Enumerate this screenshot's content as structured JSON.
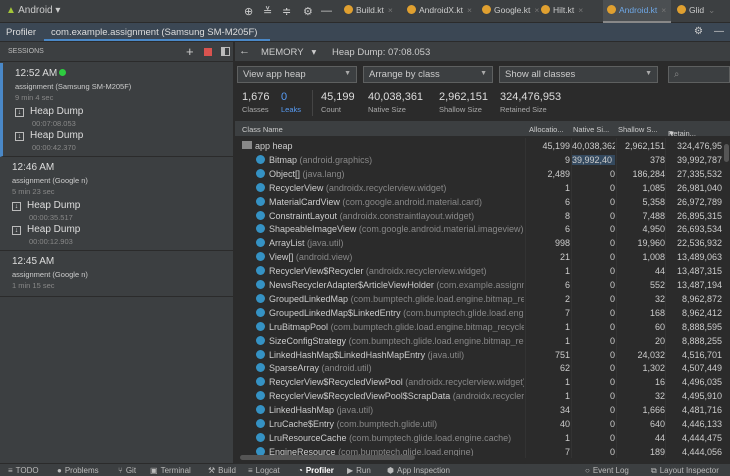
{
  "toolbar": {
    "project": "Android",
    "tabs": [
      {
        "name": "Build.kt"
      },
      {
        "name": "AndroidX.kt"
      },
      {
        "name": "Google.kt"
      },
      {
        "name": "Hilt.kt"
      },
      {
        "name": "Android.kt",
        "active": true
      },
      {
        "name": "Glid"
      }
    ]
  },
  "profiler": {
    "title": "Profiler",
    "session_tab": "com.example.assignment (Samsung SM-M205F)"
  },
  "sessions": {
    "header": "SESSIONS",
    "items": [
      {
        "time": "12:52 AM",
        "live": true,
        "device": "assignment (Samsung SM-M205F)",
        "duration": "9 min 4 sec",
        "dumps": [
          {
            "label": "Heap Dump",
            "time": "00:07:08.053"
          },
          {
            "label": "Heap Dump",
            "time": "00:00:42.370"
          }
        ]
      },
      {
        "time": "12:46 AM",
        "device": "assignment (Google n)",
        "duration": "5 min 23 sec",
        "dumps": [
          {
            "label": "Heap Dump",
            "time": "00:00:35.517"
          },
          {
            "label": "Heap Dump",
            "time": "00:00:12.903"
          }
        ]
      },
      {
        "time": "12:45 AM",
        "device": "assignment (Google n)",
        "duration": "1 min 15 sec",
        "dumps": []
      }
    ]
  },
  "memory": {
    "mode": "MEMORY",
    "heap_dump": "Heap Dump: 07:08.053",
    "filters": {
      "heap": "View app heap",
      "arrange": "Arrange by class",
      "classes": "Show all classes"
    },
    "stats": {
      "classes": "1,676",
      "classes_label": "Classes",
      "leaks": "0",
      "leaks_label": "Leaks",
      "count": "45,199",
      "count_label": "Count",
      "native": "40,038,361",
      "native_label": "Native Size",
      "shallow": "2,962,151",
      "shallow_label": "Shallow Size",
      "retained": "324,476,953",
      "retained_label": "Retained Size"
    }
  },
  "table": {
    "columns": [
      "Class Name",
      "Allocatio...",
      "Native Si...",
      "Shallow S...",
      "Retain..."
    ],
    "root": {
      "name": "app heap",
      "alloc": "45,199",
      "native": "40,038,362",
      "shallow": "2,962,151",
      "retained": "324,476,95"
    },
    "rows": [
      [
        "Bitmap",
        "(android.graphics)",
        "9",
        "39,992,40",
        "378",
        "39,992,787"
      ],
      [
        "Object[]",
        "(java.lang)",
        "2,489",
        "0",
        "186,284",
        "27,335,532"
      ],
      [
        "RecyclerView",
        "(androidx.recyclerview.widget)",
        "1",
        "0",
        "1,085",
        "26,981,040"
      ],
      [
        "MaterialCardView",
        "(com.google.android.material.card)",
        "6",
        "0",
        "5,358",
        "26,972,789"
      ],
      [
        "ConstraintLayout",
        "(androidx.constraintlayout.widget)",
        "8",
        "0",
        "7,488",
        "26,895,315"
      ],
      [
        "ShapeableImageView",
        "(com.google.android.material.imageview)",
        "6",
        "0",
        "4,950",
        "26,693,534"
      ],
      [
        "ArrayList",
        "(java.util)",
        "998",
        "0",
        "19,960",
        "22,536,932"
      ],
      [
        "View[]",
        "(android.view)",
        "21",
        "0",
        "1,008",
        "13,489,063"
      ],
      [
        "RecyclerView$Recycler",
        "(androidx.recyclerview.widget)",
        "1",
        "0",
        "44",
        "13,487,315"
      ],
      [
        "NewsRecyclerAdapter$ArticleViewHolder",
        "(com.example.assignment)",
        "6",
        "0",
        "552",
        "13,487,194"
      ],
      [
        "GroupedLinkedMap",
        "(com.bumptech.glide.load.engine.bitmap_recycle)",
        "2",
        "0",
        "32",
        "8,962,872"
      ],
      [
        "GroupedLinkedMap$LinkedEntry",
        "(com.bumptech.glide.load.engine)",
        "7",
        "0",
        "168",
        "8,962,412"
      ],
      [
        "LruBitmapPool",
        "(com.bumptech.glide.load.engine.bitmap_recycle)",
        "1",
        "0",
        "60",
        "8,888,595"
      ],
      [
        "SizeConfigStrategy",
        "(com.bumptech.glide.load.engine.bitmap_recycle)",
        "1",
        "0",
        "20",
        "8,888,255"
      ],
      [
        "LinkedHashMap$LinkedHashMapEntry",
        "(java.util)",
        "751",
        "0",
        "24,032",
        "4,516,701"
      ],
      [
        "SparseArray",
        "(android.util)",
        "62",
        "0",
        "1,302",
        "4,507,449"
      ],
      [
        "RecyclerView$RecycledViewPool",
        "(androidx.recyclerview.widget)",
        "1",
        "0",
        "16",
        "4,496,035"
      ],
      [
        "RecyclerView$RecycledViewPool$ScrapData",
        "(androidx.recyclerview.widget)",
        "1",
        "0",
        "32",
        "4,495,910"
      ],
      [
        "LinkedHashMap",
        "(java.util)",
        "34",
        "0",
        "1,666",
        "4,481,716"
      ],
      [
        "LruCache$Entry",
        "(com.bumptech.glide.util)",
        "40",
        "0",
        "640",
        "4,446,133"
      ],
      [
        "LruResourceCache",
        "(com.bumptech.glide.load.engine.cache)",
        "1",
        "0",
        "44",
        "4,444,475"
      ],
      [
        "EngineResource",
        "(com.bumptech.glide.load.engine)",
        "7",
        "0",
        "189",
        "4,444,056"
      ]
    ]
  },
  "bottom": {
    "left": [
      "TODO",
      "Problems",
      "Git",
      "Terminal",
      "Build",
      "Logcat",
      "Profiler",
      "Run",
      "App Inspection"
    ],
    "right": [
      "Event Log",
      "Layout Inspector"
    ]
  }
}
